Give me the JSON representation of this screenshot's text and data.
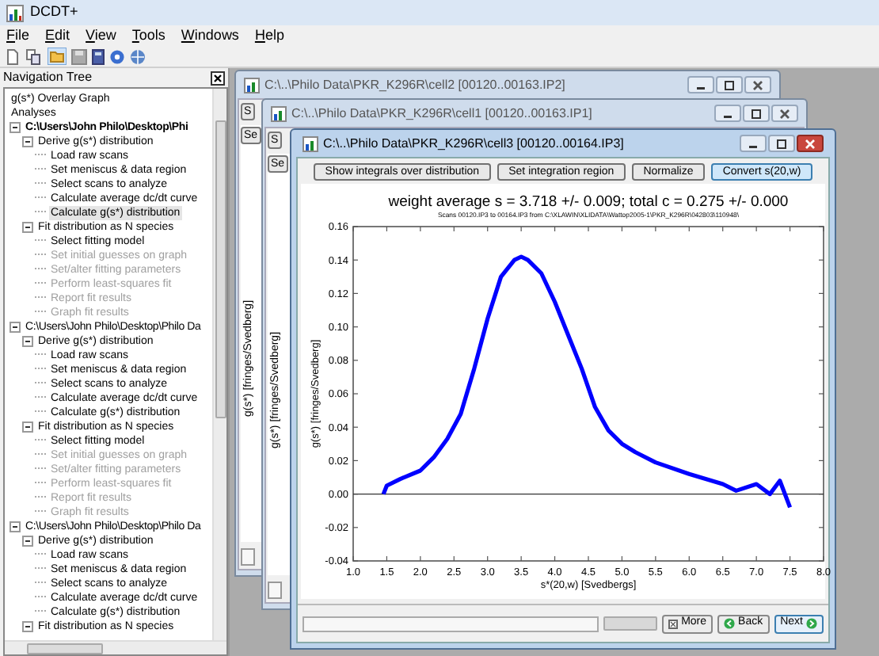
{
  "app": {
    "title": "DCDT+"
  },
  "menu": [
    "File",
    "Edit",
    "View",
    "Tools",
    "Windows",
    "Help"
  ],
  "navigation": {
    "title": "Navigation Tree",
    "items": [
      {
        "label": "g(s*) Overlay Graph"
      },
      {
        "label": "Analyses"
      },
      {
        "label": "C:\\Users\\John Philo\\Desktop\\Phi",
        "active": true,
        "expanded": true,
        "children": [
          {
            "label": "Derive g(s*) distribution",
            "expanded": true,
            "children": [
              {
                "label": "Load raw scans",
                "disabled": false,
                "selected": false
              },
              {
                "label": "Set meniscus & data region",
                "disabled": false,
                "selected": false
              },
              {
                "label": "Select scans to analyze",
                "disabled": false,
                "selected": false
              },
              {
                "label": "Calculate average dc/dt curve",
                "disabled": false,
                "selected": false
              },
              {
                "label": "Calculate g(s*) distribution",
                "disabled": false,
                "selected": true
              }
            ]
          },
          {
            "label": "Fit distribution as N species",
            "expanded": true,
            "children": [
              {
                "label": "Select fitting model",
                "disabled": false,
                "selected": false
              },
              {
                "label": "Set initial guesses on graph",
                "disabled": true,
                "selected": false
              },
              {
                "label": "Set/alter fitting parameters",
                "disabled": true,
                "selected": false
              },
              {
                "label": "Perform least-squares fit",
                "disabled": true,
                "selected": false
              },
              {
                "label": "Report fit results",
                "disabled": true,
                "selected": false
              },
              {
                "label": "Graph fit results",
                "disabled": true,
                "selected": false
              }
            ]
          }
        ]
      },
      {
        "label": "C:\\Users\\John Philo\\Desktop\\Philo Da",
        "active": false,
        "expanded": true,
        "children": [
          {
            "label": "Derive g(s*) distribution",
            "expanded": true,
            "children": [
              {
                "label": "Load raw scans",
                "disabled": false,
                "selected": false
              },
              {
                "label": "Set meniscus & data region",
                "disabled": false,
                "selected": false
              },
              {
                "label": "Select scans to analyze",
                "disabled": false,
                "selected": false
              },
              {
                "label": "Calculate average dc/dt curve",
                "disabled": false,
                "selected": false
              },
              {
                "label": "Calculate g(s*) distribution",
                "disabled": false,
                "selected": false
              }
            ]
          },
          {
            "label": "Fit distribution as N species",
            "expanded": true,
            "children": [
              {
                "label": "Select fitting model",
                "disabled": false,
                "selected": false
              },
              {
                "label": "Set initial guesses on graph",
                "disabled": true,
                "selected": false
              },
              {
                "label": "Set/alter fitting parameters",
                "disabled": true,
                "selected": false
              },
              {
                "label": "Perform least-squares fit",
                "disabled": true,
                "selected": false
              },
              {
                "label": "Report fit results",
                "disabled": true,
                "selected": false
              },
              {
                "label": "Graph fit results",
                "disabled": true,
                "selected": false
              }
            ]
          }
        ]
      },
      {
        "label": "C:\\Users\\John Philo\\Desktop\\Philo Da",
        "active": false,
        "expanded": true,
        "children": [
          {
            "label": "Derive g(s*) distribution",
            "expanded": true,
            "children": [
              {
                "label": "Load raw scans",
                "disabled": false,
                "selected": false
              },
              {
                "label": "Set meniscus & data region",
                "disabled": false,
                "selected": false
              },
              {
                "label": "Select scans to analyze",
                "disabled": false,
                "selected": false
              },
              {
                "label": "Calculate average dc/dt curve",
                "disabled": false,
                "selected": false
              },
              {
                "label": "Calculate g(s*) distribution",
                "disabled": false,
                "selected": false
              }
            ]
          },
          {
            "label": "Fit distribution as N species",
            "expanded": true
          }
        ]
      }
    ]
  },
  "back_windows": [
    {
      "title": "C:\\..\\Philo Data\\PKR_K296R\\cell2 [00120..00163.IP2]",
      "buttons": [
        "S",
        "Se"
      ],
      "ylabel": "g(s*) [fringes/Svedberg]"
    },
    {
      "title": "C:\\..\\Philo Data\\PKR_K296R\\cell1 [00120..00163.IP1]",
      "buttons": [
        "S",
        "Se"
      ],
      "ylabel": "g(s*) [fringes/Svedberg]"
    }
  ],
  "front_window": {
    "title": "C:\\..\\Philo Data\\PKR_K296R\\cell3 [00120..00164.IP3]",
    "buttons": [
      {
        "label": "Show integrals over distribution",
        "default": false
      },
      {
        "label": "Set integration region",
        "default": false
      },
      {
        "label": "Normalize",
        "default": false
      },
      {
        "label": "Convert s(20,w)",
        "default": true
      }
    ],
    "subtitle": "Scans 00120.IP3 to 00164.IP3 from C:\\XLAWIN\\XLIDATA\\Wattop2005-1\\PKR_K296R\\042803\\110948\\",
    "chart_data": {
      "type": "line",
      "title": "weight average s = 3.718 +/- 0.009; total c = 0.275 +/- 0.000",
      "xlabel": "s*(20,w) [Svedbergs]",
      "ylabel": "g(s*) [fringes/Svedberg]",
      "x": [
        1.45,
        1.5,
        1.7,
        2.0,
        2.2,
        2.4,
        2.6,
        2.8,
        3.0,
        3.2,
        3.4,
        3.5,
        3.6,
        3.8,
        4.0,
        4.2,
        4.4,
        4.6,
        4.8,
        5.0,
        5.2,
        5.5,
        6.0,
        6.5,
        6.7,
        7.0,
        7.2,
        7.35,
        7.5
      ],
      "series": [
        {
          "color": "#0000ff",
          "values": [
            0.0,
            0.005,
            0.009,
            0.014,
            0.022,
            0.033,
            0.048,
            0.075,
            0.105,
            0.13,
            0.14,
            0.142,
            0.14,
            0.132,
            0.115,
            0.095,
            0.075,
            0.052,
            0.038,
            0.03,
            0.025,
            0.019,
            0.012,
            0.006,
            0.002,
            0.006,
            0.0,
            0.008,
            -0.008
          ]
        }
      ],
      "xlim": [
        1.0,
        8.0
      ],
      "ylim": [
        -0.04,
        0.16
      ],
      "xticks": [
        {
          "value": 1,
          "label": "1.0"
        },
        {
          "value": 1.5,
          "label": "1.5"
        },
        {
          "value": 2,
          "label": "2.0"
        },
        {
          "value": 2.5,
          "label": "2.5"
        },
        {
          "value": 3,
          "label": "3.0"
        },
        {
          "value": 3.5,
          "label": "3.5"
        },
        {
          "value": 4,
          "label": "4.0"
        },
        {
          "value": 4.5,
          "label": "4.5"
        },
        {
          "value": 5,
          "label": "5.0"
        },
        {
          "value": 5.5,
          "label": "5.5"
        },
        {
          "value": 6,
          "label": "6.0"
        },
        {
          "value": 6.5,
          "label": "6.5"
        },
        {
          "value": 7,
          "label": "7.0"
        },
        {
          "value": 7.5,
          "label": "7.5"
        },
        {
          "value": 8,
          "label": "8.0"
        }
      ],
      "yticks": [
        {
          "value": -0.04,
          "label": "-0.04"
        },
        {
          "value": -0.02,
          "label": "-0.02"
        },
        {
          "value": 0,
          "label": "0.00"
        },
        {
          "value": 0.02,
          "label": "0.02"
        },
        {
          "value": 0.04,
          "label": "0.04"
        },
        {
          "value": 0.06,
          "label": "0.06"
        },
        {
          "value": 0.08,
          "label": "0.08"
        },
        {
          "value": 0.1,
          "label": "0.10"
        },
        {
          "value": 0.12,
          "label": "0.12"
        },
        {
          "value": 0.14,
          "label": "0.14"
        },
        {
          "value": 0.16,
          "label": "0.16"
        }
      ]
    },
    "footer_buttons": [
      {
        "kind": "more",
        "label": "More"
      },
      {
        "kind": "back",
        "label": "Back"
      },
      {
        "kind": "next",
        "label": "Next"
      }
    ]
  }
}
